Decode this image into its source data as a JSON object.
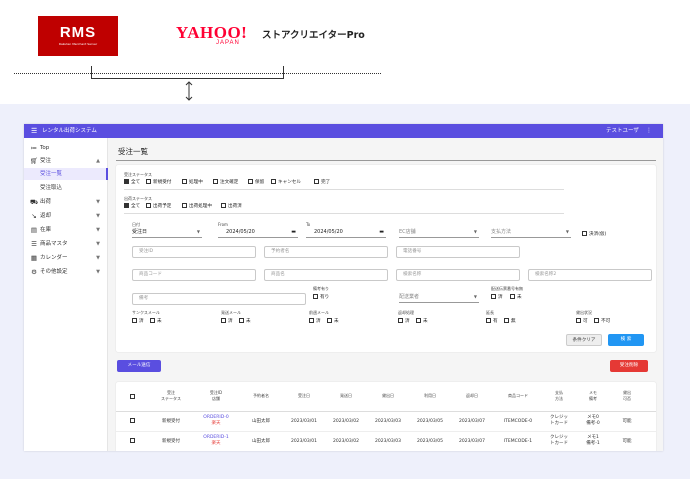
{
  "header": {
    "rms_logo": "RMS",
    "rms_sub": "Rakuten Merchant Server",
    "yahoo_logo": "YAHOO!",
    "yahoo_japan": "JAPAN",
    "yahoo_product": "ストアクリエイターPro"
  },
  "app": {
    "title": "レンタル出荷システム",
    "user": "テストユーザ"
  },
  "sidebar": {
    "items": [
      {
        "label": "Top",
        "icon": "list-icon"
      },
      {
        "label": "受注",
        "icon": "cart-icon"
      },
      {
        "label": "受注一覧"
      },
      {
        "label": "受注取込"
      },
      {
        "label": "出荷",
        "icon": "truck-icon"
      },
      {
        "label": "返却",
        "icon": "return-icon"
      },
      {
        "label": "在庫",
        "icon": "inventory-icon"
      },
      {
        "label": "商品マスタ",
        "icon": "list-icon"
      },
      {
        "label": "カレンダー",
        "icon": "calendar-icon"
      },
      {
        "label": "その他設定",
        "icon": "gear-icon"
      }
    ]
  },
  "page": {
    "title": "受注一覧"
  },
  "filters": {
    "order_status_label": "受注ステータス",
    "order_status": [
      "全て",
      "新規受付",
      "処理中",
      "注文確定",
      "保留",
      "キャンセル",
      "完了"
    ],
    "ship_status_label": "出荷ステータス",
    "ship_status": [
      "全て",
      "出荷予定",
      "出荷処理中",
      "出荷済"
    ],
    "date_type_label": "日付",
    "date_type_value": "受注日",
    "from_label": "From",
    "from_value": "2024/05/20",
    "to_label": "To",
    "to_value": "2024/05/20",
    "ec_store_placeholder": "EC店舗",
    "payment_placeholder": "支払方法",
    "payment_done": "決済(仮)",
    "order_id_placeholder": "受注ID",
    "reserver_placeholder": "予約者名",
    "phone_placeholder": "電話番号",
    "product_code_placeholder": "商品コード",
    "product_name_placeholder": "商品名",
    "search_name_placeholder": "検索名称",
    "search_name2_placeholder": "検索名称2",
    "remarks_placeholder": "備考",
    "remarks_flag_label": "備考有り",
    "remarks_flag": "有り",
    "carrier_placeholder": "配送業者",
    "tracking_label": "配送伝票番号有無",
    "thanks_mail_label": "サンクスメール",
    "ship_mail_label": "発送メール",
    "return_mail_label": "前週メール",
    "return_confirm_label": "返却処理",
    "extension_label": "延長",
    "rental_label": "貸出状況",
    "opt_done": "済",
    "opt_undone": "未",
    "opt_yes": "有",
    "opt_no": "無",
    "opt_ok": "可",
    "opt_ng": "不可"
  },
  "buttons": {
    "clear": "条件クリア",
    "search": "検 索",
    "send_mail": "メール送信",
    "delete": "受注削除"
  },
  "table": {
    "headers": [
      "受注\nステータス",
      "受注ID\n店舗",
      "予約者名",
      "受注日",
      "発送日",
      "貸出日",
      "利用日",
      "返却日",
      "商品コード",
      "支払\n方法",
      "メモ\n備考",
      "貸出\n可否"
    ],
    "rows": [
      [
        "新規受付",
        "ORDERID-0",
        "楽天",
        "山田太郎",
        "2023/03/01",
        "2023/03/02",
        "2023/03/03",
        "2023/03/05",
        "2023/03/07",
        "ITEMCODE-0",
        "クレジッ\nトカード",
        "メモ0\n備考-0",
        "可能"
      ],
      [
        "新規受付",
        "ORDERID-1",
        "楽天",
        "山田太郎",
        "2023/03/01",
        "2023/03/02",
        "2023/03/03",
        "2023/03/05",
        "2023/03/07",
        "ITEMCODE-1",
        "クレジッ\nトカード",
        "メモ1\n備考-1",
        "可能"
      ]
    ]
  },
  "colors": {
    "primary": "#5a4ee0",
    "danger": "#e53935",
    "rakuten": "#bf0000",
    "yahoo": "#ff0033"
  }
}
